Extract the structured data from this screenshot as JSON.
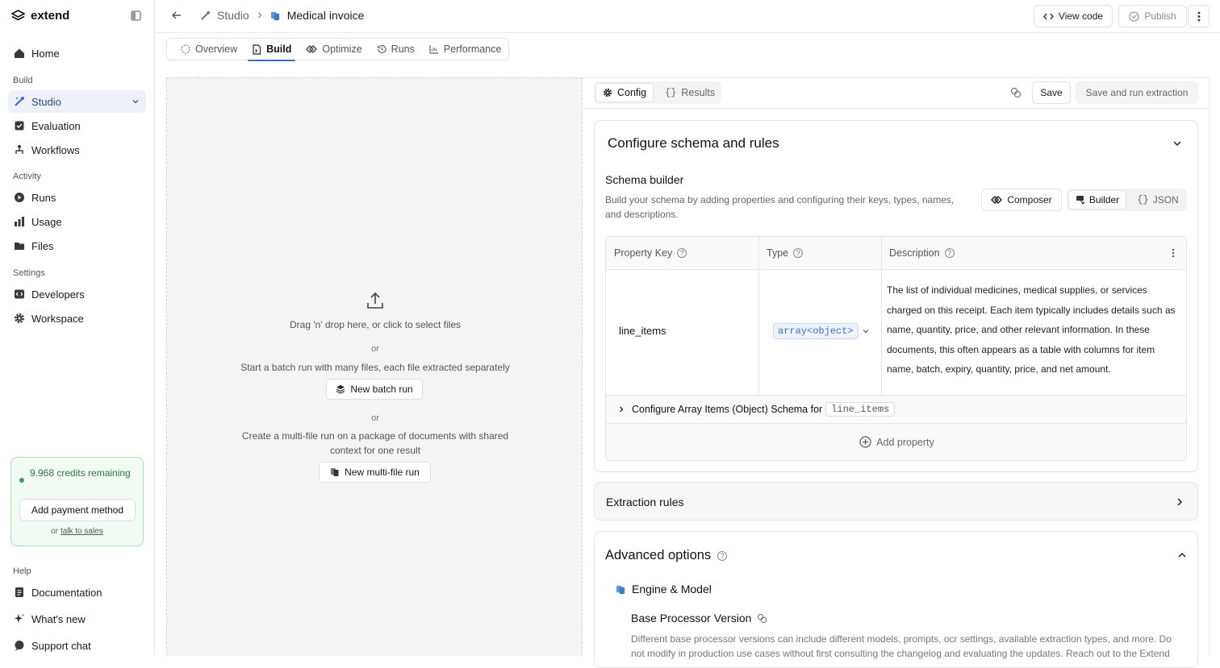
{
  "app": {
    "name": "extend"
  },
  "sidebar": {
    "home": "Home",
    "sections": {
      "build": "Build",
      "activity": "Activity",
      "settings": "Settings",
      "help": "Help"
    },
    "build_items": [
      "Studio",
      "Evaluation",
      "Workflows"
    ],
    "activity_items": [
      "Runs",
      "Usage",
      "Files"
    ],
    "settings_items": [
      "Developers",
      "Workspace"
    ],
    "help_items": [
      "Documentation",
      "What's new",
      "Support chat"
    ],
    "credits": {
      "text": "9.968 credits remaining",
      "button": "Add payment method",
      "or": "or",
      "sales_link": "talk to sales"
    }
  },
  "header": {
    "breadcrumb_parent": "Studio",
    "breadcrumb_current": "Medical invoice",
    "view_code": "View code",
    "publish": "Publish"
  },
  "tabs": [
    "Overview",
    "Build",
    "Optimize",
    "Runs",
    "Performance"
  ],
  "upload": {
    "drop_text": "Drag 'n' drop here, or click to select files",
    "or": "or",
    "batch_text": "Start a batch run with many files, each file extracted separately",
    "batch_button": "New batch run",
    "multi_text_1": "Create a multi-file run on a package of documents with shared",
    "multi_text_2": "context for one result",
    "multi_button": "New multi-file run"
  },
  "config": {
    "tab_config": "Config",
    "tab_results": "Results",
    "save": "Save",
    "save_run": "Save and run extraction",
    "schema_title": "Configure schema and rules",
    "builder_title": "Schema builder",
    "builder_desc_1": "Build your schema by adding properties and configuring their keys, types, names,",
    "builder_desc_2": "and descriptions.",
    "mode_composer": "Composer",
    "mode_builder": "Builder",
    "mode_json": "JSON",
    "table": {
      "col_key": "Property Key",
      "col_type": "Type",
      "col_desc": "Description",
      "row_key": "line_items",
      "row_type": "array<object>",
      "row_desc_lines": [
        "The list of individual medicines, medical supplies, or services",
        "charged on this receipt. Each item typically includes details such as",
        "name, quantity, price, and other relevant information. In these",
        "documents, this often appears as a table with columns for item",
        "name, batch, expiry, quantity, price, and net amount."
      ],
      "configure_text": "Configure Array Items (Object) Schema for",
      "configure_key": "line_items",
      "add_property": "Add property"
    },
    "extraction_rules": "Extraction rules",
    "advanced_title": "Advanced options",
    "engine_title": "Engine & Model",
    "base_title": "Base Processor Version",
    "base_desc_1": "Different base processor versions can include different models, prompts, ocr settings, available extraction types, and more. Do",
    "base_desc_2": "not modify in production use cases without first consulting the changelog and evaluating the updates. Reach out to the Extend"
  }
}
